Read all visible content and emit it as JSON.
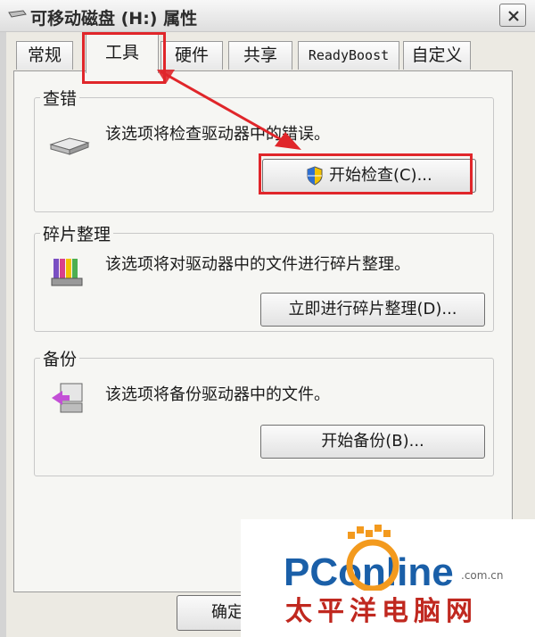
{
  "window": {
    "title": "可移动磁盘 (H:) 属性"
  },
  "tabs": [
    {
      "label": "常规"
    },
    {
      "label": "工具"
    },
    {
      "label": "硬件"
    },
    {
      "label": "共享"
    },
    {
      "label": "ReadyBoost"
    },
    {
      "label": "自定义"
    }
  ],
  "groups": {
    "error_check": {
      "title": "查错",
      "description": "该选项将检查驱动器中的错误。",
      "button": "开始检查(C)..."
    },
    "defrag": {
      "title": "碎片整理",
      "description": "该选项将对驱动器中的文件进行碎片整理。",
      "button": "立即进行碎片整理(D)..."
    },
    "backup": {
      "title": "备份",
      "description": "该选项将备份驱动器中的文件。",
      "button": "开始备份(B)..."
    }
  },
  "bottom": {
    "ok_button": "确定"
  },
  "watermark": {
    "logo_text": "PConline",
    "domain": ".com.cn",
    "chinese": "太平洋电脑网"
  },
  "colors": {
    "highlight_red": "#e0262a",
    "watermark_blue": "#1a5fa8",
    "watermark_orange": "#f39a1e"
  }
}
